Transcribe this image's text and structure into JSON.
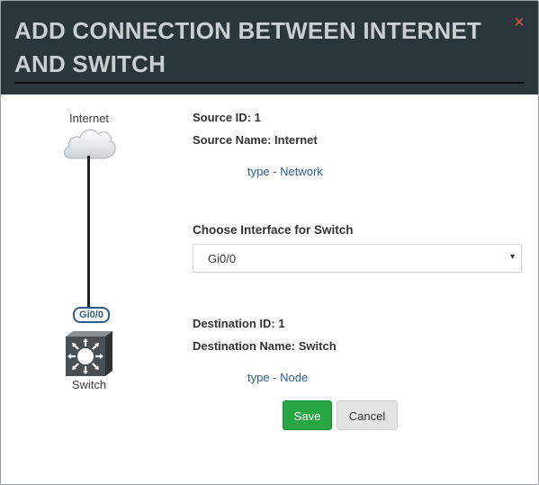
{
  "header": {
    "title": "ADD CONNECTION BETWEEN INTERNET AND SWITCH",
    "close_symbol": "×"
  },
  "graph": {
    "source_node_label": "Internet",
    "source_node_icon": "cloud-icon",
    "destination_node_label": "Switch",
    "destination_node_icon": "switch-icon",
    "interface_badge": "Gi0/0"
  },
  "source": {
    "id_text": "Source ID: 1",
    "name_text": "Source Name: Internet",
    "type_text": "type - Network"
  },
  "interface": {
    "label": "Choose Interface for Switch",
    "selected_value": "Gi0/0",
    "caret": "▾"
  },
  "destination": {
    "id_text": "Destination ID: 1",
    "name_text": "Destination Name: Switch",
    "type_text": "type - Node"
  },
  "buttons": {
    "save_label": "Save",
    "cancel_label": "Cancel"
  },
  "colors": {
    "header_bg": "#2a353c",
    "title_text": "#c9cfd3",
    "close": "#d9534f",
    "link": "#2f5d97",
    "save": "#28a745",
    "cancel": "#e3e3e3"
  }
}
